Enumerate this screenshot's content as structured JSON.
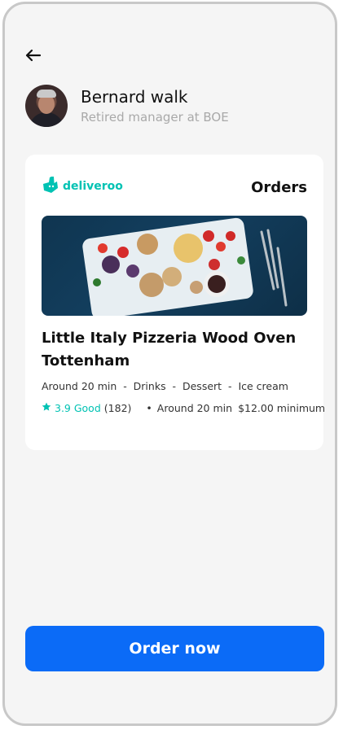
{
  "profile": {
    "name": "Bernard walk",
    "subtitle": "Retired manager at BOE"
  },
  "card": {
    "brand": "deliveroo",
    "section_title": "Orders",
    "restaurant_title": "Little Italy Pizzeria Wood Oven Tottenham",
    "meta_line": "Around 20 min  -  Drinks  -  Dessert  -  Ice cream",
    "rating_value": "3.9 Good",
    "rating_count": "(182)",
    "separator": "•",
    "duration": "Around 20 min",
    "minimum": "$12.00 minimum"
  },
  "cta": {
    "label": "Order now"
  },
  "colors": {
    "accent": "#0b6bf7",
    "brand_teal": "#00c2b3",
    "background": "#f5f5f5"
  },
  "icons": [
    "back-arrow-icon",
    "deliveroo-logo-icon",
    "star-icon"
  ]
}
